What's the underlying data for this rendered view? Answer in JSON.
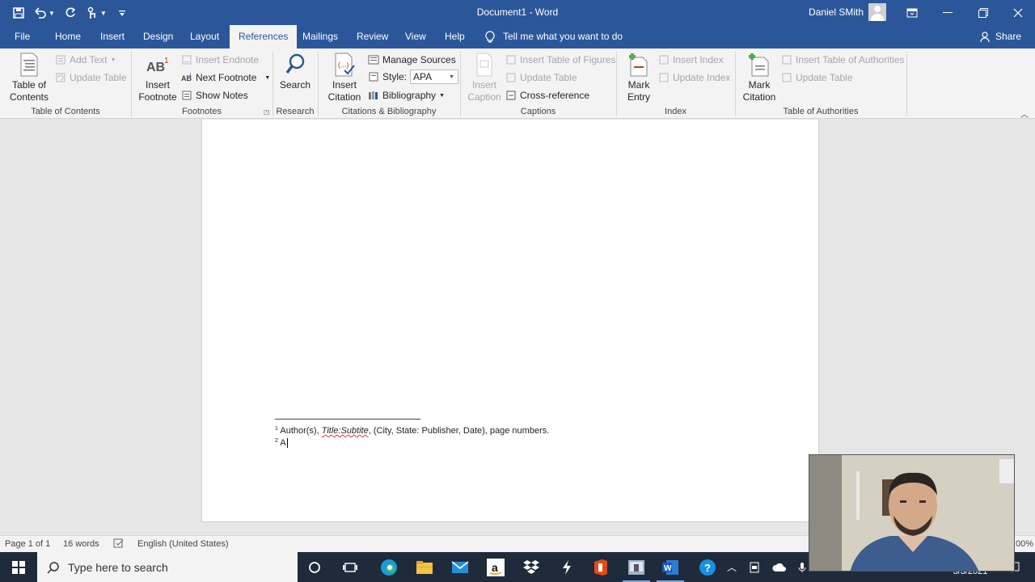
{
  "window": {
    "doc_title": "Document1  -  Word",
    "user_name": "Daniel SMith"
  },
  "tabs": [
    "File",
    "Home",
    "Insert",
    "Design",
    "Layout",
    "References",
    "Mailings",
    "Review",
    "View",
    "Help"
  ],
  "active_tab": "References",
  "tell_me": "Tell me what you want to do",
  "share_label": "Share",
  "ribbon": {
    "toc": {
      "button": "Table of\nContents",
      "add_text": "Add Text",
      "update_table": "Update Table",
      "group": "Table of Contents"
    },
    "footnotes": {
      "insert_footnote": "Insert\nFootnote",
      "insert_endnote": "Insert Endnote",
      "next_footnote": "Next Footnote",
      "show_notes": "Show Notes",
      "group": "Footnotes"
    },
    "research": {
      "search": "Search",
      "group": "Research"
    },
    "citations": {
      "insert_citation": "Insert\nCitation",
      "manage_sources": "Manage Sources",
      "style_label": "Style:",
      "style_value": "APA",
      "bibliography": "Bibliography",
      "group": "Citations & Bibliography"
    },
    "captions": {
      "insert_caption": "Insert\nCaption",
      "insert_table_of_figures": "Insert Table of Figures",
      "update_table": "Update Table",
      "cross_reference": "Cross-reference",
      "group": "Captions"
    },
    "index": {
      "mark_entry": "Mark\nEntry",
      "insert_index": "Insert Index",
      "update_index": "Update Index",
      "group": "Index"
    },
    "authorities": {
      "mark_citation": "Mark\nCitation",
      "insert_toa": "Insert Table of Authorities",
      "update_table": "Update Table",
      "group": "Table of Authorities"
    }
  },
  "document": {
    "footnote1": {
      "num": "1",
      "pre": "Author(s), ",
      "italic": "Title:Subtite",
      "post": ", (City, State: Publisher, Date), page numbers."
    },
    "footnote2": {
      "num": "2",
      "text": "A"
    }
  },
  "status": {
    "page": "Page 1 of 1",
    "words": "16 words",
    "language": "English (United States)",
    "zoom": "00%"
  },
  "taskbar": {
    "search_placeholder": "Type here to search",
    "date": "3/3/2021"
  }
}
